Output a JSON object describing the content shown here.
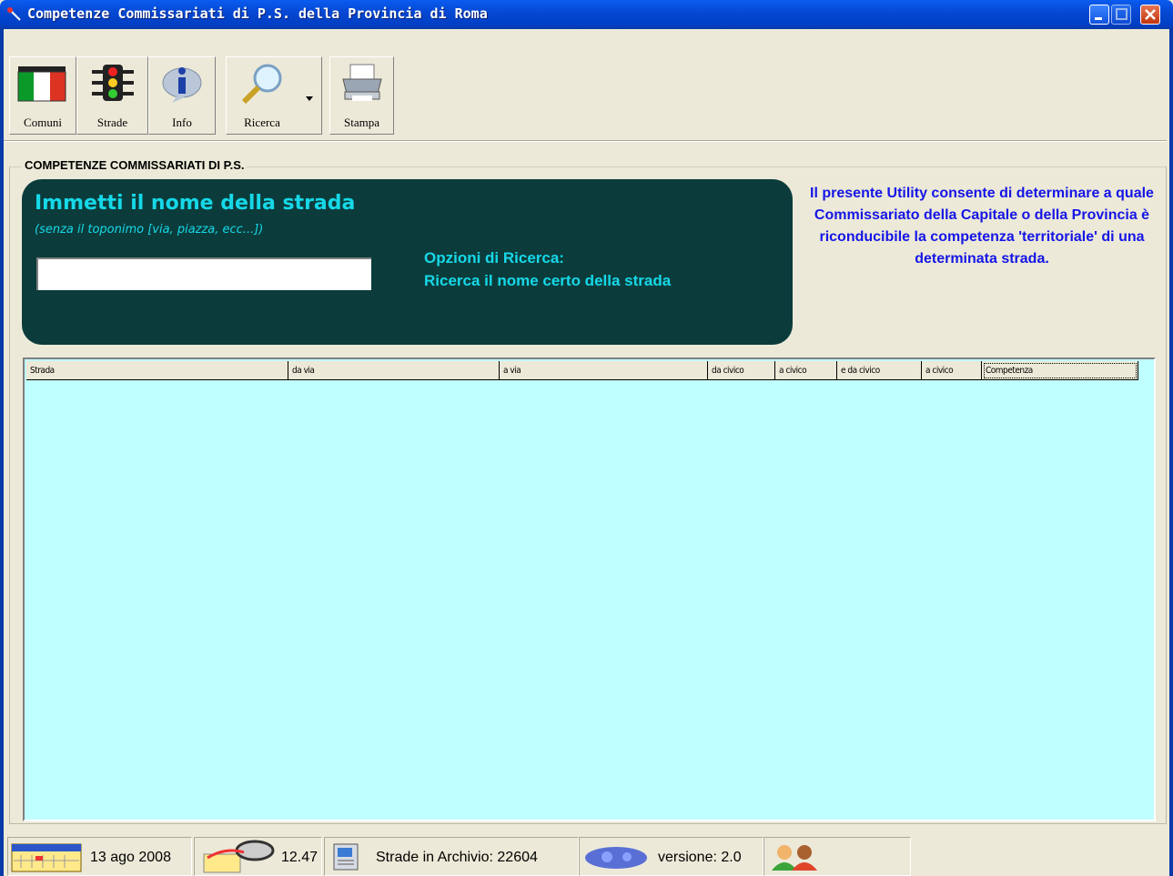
{
  "window": {
    "title": "Competenze Commissariati di P.S. della Provincia di Roma"
  },
  "toolbar": {
    "comuni": "Comuni",
    "strade": "Strade",
    "info": "Info",
    "ricerca": "Ricerca",
    "stampa": "Stampa"
  },
  "group": {
    "legend": "COMPETENZE COMMISSARIATI DI P.S."
  },
  "search": {
    "title": "Immetti il nome della strada",
    "subtitle": "(senza il toponimo [via, piazza, ecc...])",
    "value": "",
    "options_label": "Opzioni di Ricerca:",
    "options_value": "Ricerca il nome certo della strada"
  },
  "info_text": "Il presente Utility consente di determinare a quale Commissariato della Capitale o della Provincia è riconducibile la competenza 'territoriale' di una determinata strada.",
  "grid": {
    "columns": [
      "Strada",
      "da via",
      "a via",
      "da civico",
      "a civico",
      "e da civico",
      "a civico",
      "Competenza"
    ],
    "rows": []
  },
  "status": {
    "date": "13 ago 2008",
    "time": "12.47",
    "archive": "Strade in Archivio: 22604",
    "version": "versione: 2.0"
  },
  "colors": {
    "panel": "#0b3c3b",
    "panel_text": "#16d8e8",
    "grid_bg": "#c0ffff",
    "info_text": "#1515e6"
  }
}
